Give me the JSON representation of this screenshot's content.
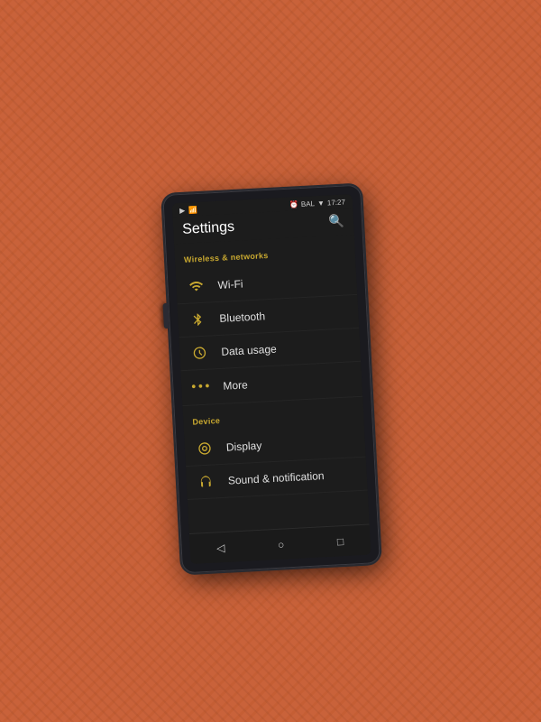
{
  "phone": {
    "statusBar": {
      "leftIcons": [
        "media-icon",
        "sim-icon"
      ],
      "time": "17:27",
      "batteryLabel": "BAL"
    },
    "header": {
      "title": "Settings",
      "searchLabel": "🔍"
    },
    "sections": [
      {
        "id": "wireless",
        "label": "Wireless & networks",
        "items": [
          {
            "id": "wifi",
            "label": "Wi-Fi",
            "icon": "wifi"
          },
          {
            "id": "bluetooth",
            "label": "Bluetooth",
            "icon": "bluetooth"
          },
          {
            "id": "data-usage",
            "label": "Data usage",
            "icon": "data"
          },
          {
            "id": "more",
            "label": "More",
            "icon": "more"
          }
        ]
      },
      {
        "id": "device",
        "label": "Device",
        "items": [
          {
            "id": "display",
            "label": "Display",
            "icon": "display"
          },
          {
            "id": "sound",
            "label": "Sound & notification",
            "icon": "sound"
          }
        ]
      }
    ],
    "navBar": {
      "back": "◁",
      "home": "○",
      "recent": "□"
    }
  }
}
